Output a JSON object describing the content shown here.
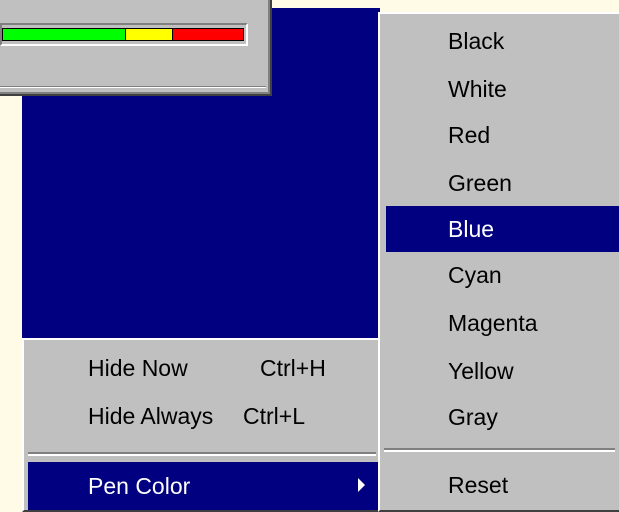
{
  "meter": {
    "segments": [
      {
        "color": "#00ff00",
        "fraction": 0.53
      },
      {
        "color": "#ffff00",
        "fraction": 0.2
      },
      {
        "color": "#ff0000",
        "fraction": 0.27
      }
    ]
  },
  "context_menu": {
    "items": [
      {
        "label": "Hide Now",
        "shortcut": "Ctrl+H"
      },
      {
        "label": "Hide Always",
        "shortcut": "Ctrl+L"
      },
      {
        "label": "Pen Color",
        "shortcut": ""
      }
    ],
    "selected": "Pen Color"
  },
  "pen_color_submenu": {
    "items": [
      "Black",
      "White",
      "Red",
      "Green",
      "Blue",
      "Cyan",
      "Magenta",
      "Yellow",
      "Gray",
      "Reset"
    ],
    "selected": "Blue"
  },
  "colors": {
    "menu_bg": "#c0c0c0",
    "highlight": "#000080",
    "desktop": "#000080",
    "background": "#fffbe6"
  }
}
